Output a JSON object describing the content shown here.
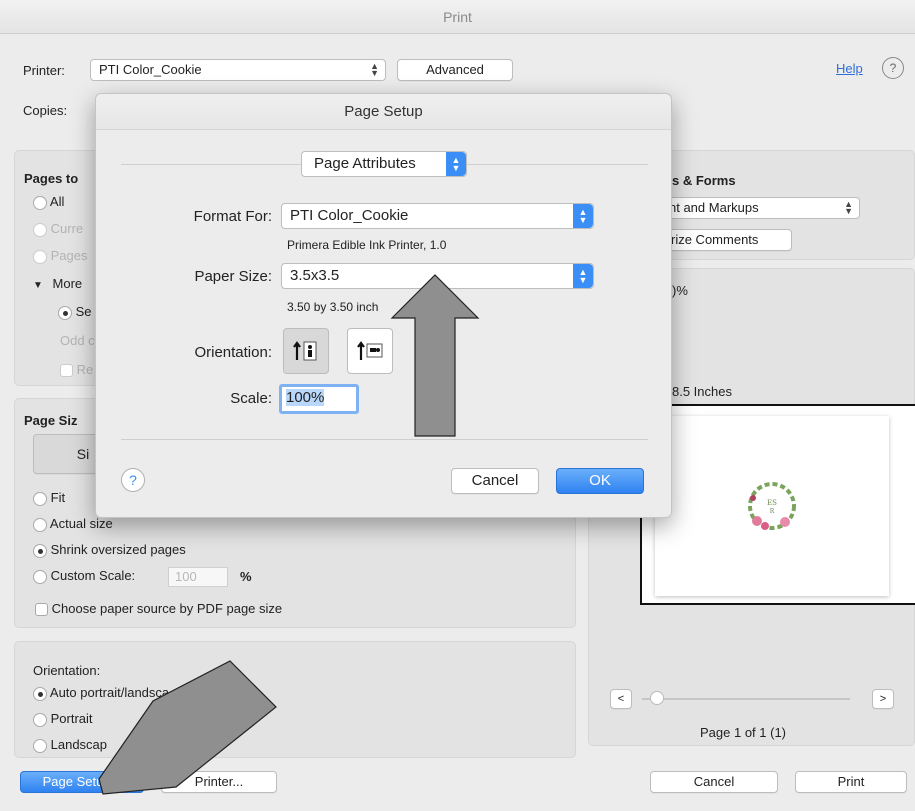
{
  "window": {
    "title": "Print"
  },
  "top": {
    "printer_label": "Printer:",
    "printer_value": "PTI Color_Cookie",
    "advanced_label": "Advanced",
    "help_link": "Help",
    "copies_label": "Copies:"
  },
  "pages": {
    "title": "Pages to",
    "all": "All",
    "current": "Curre",
    "pages": "Pages",
    "more": "More",
    "odd": "Odd c"
  },
  "page_sizing": {
    "title": "Page Siz",
    "tab_size": "Si",
    "fit": "Fit",
    "actual": "Actual size",
    "shrink": "Shrink oversized pages",
    "custom": "Custom Scale:",
    "custom_value": "100",
    "custom_unit": "%",
    "choose_source": "Choose paper source by PDF page size"
  },
  "orientation": {
    "title": "Orientation:",
    "auto": "Auto portrait/landsca",
    "portrait": "Portrait",
    "landscape": "Landscap"
  },
  "comments": {
    "title": "s & Forms",
    "select": "nt and Markups",
    "summarize": "rize Comments"
  },
  "preview": {
    "zoom": ")%",
    "size": "8.5 Inches",
    "page_label": "Page 1 of 1 (1)"
  },
  "bottom": {
    "page_setup": "Page Setup...",
    "printer": "Printer...",
    "cancel": "Cancel",
    "print": "Print"
  },
  "sheet": {
    "title": "Page Setup",
    "attributes": "Page Attributes",
    "format_label": "Format For:",
    "format_value": "PTI Color_Cookie",
    "format_sub": "Primera Edible Ink Printer, 1.0",
    "paper_label": "Paper Size:",
    "paper_value": "3.5x3.5",
    "paper_sub": "3.50 by 3.50 inch",
    "orientation_label": "Orientation:",
    "scale_label": "Scale:",
    "scale_value": "100%",
    "cancel": "Cancel",
    "ok": "OK",
    "help": "?"
  },
  "colors": {
    "accent": "#3b8ef5",
    "arrow": "#8f8f8f"
  },
  "icons": [
    "help-circle-icon",
    "stepper-icon",
    "portrait-icon",
    "landscape-icon",
    "prev-page-icon",
    "next-page-icon"
  ]
}
